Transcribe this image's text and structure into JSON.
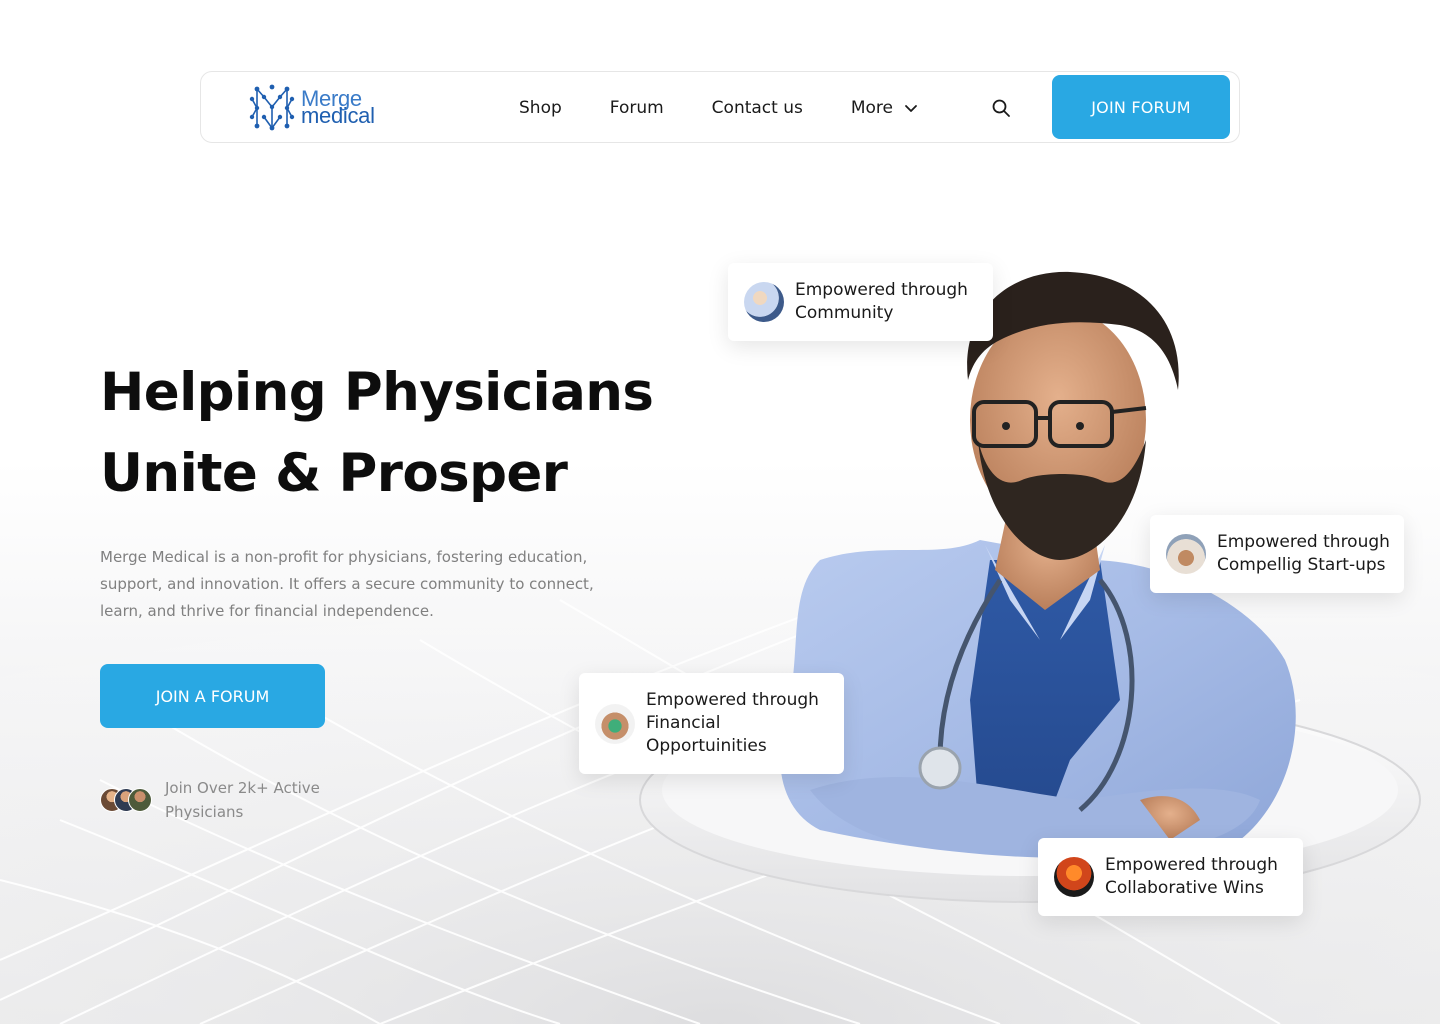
{
  "brand": {
    "line1": "Merge",
    "line2": "medical",
    "primary_color": "#29a8e3",
    "logo_color": "#1f5fb0"
  },
  "nav": {
    "items": [
      {
        "label": "Shop"
      },
      {
        "label": "Forum"
      },
      {
        "label": "Contact us"
      },
      {
        "label": "More",
        "icon": "chevron-down-icon"
      }
    ],
    "search_icon": "search-icon",
    "cta_label": "JOIN FORUM"
  },
  "hero": {
    "title_line1": "Helping Physicians",
    "title_line2": "Unite & Prosper",
    "description": "Merge Medical is a non-profit for physicians, fostering education, support, and innovation. It offers a secure community to connect, learn, and thrive for financial independence.",
    "cta_label": "JOIN A FORUM",
    "members_text": "Join Over 2k+ Active Physicians"
  },
  "cards": [
    {
      "text": "Empowered through Community",
      "thumb": "community-photo"
    },
    {
      "text": "Empowered through Compellig Start-ups",
      "thumb": "startups-photo"
    },
    {
      "text": "Empowered through Financial Opportuinities",
      "thumb": "financial-photo"
    },
    {
      "text": "Empowered through Collaborative Wins",
      "thumb": "wins-photo"
    }
  ]
}
